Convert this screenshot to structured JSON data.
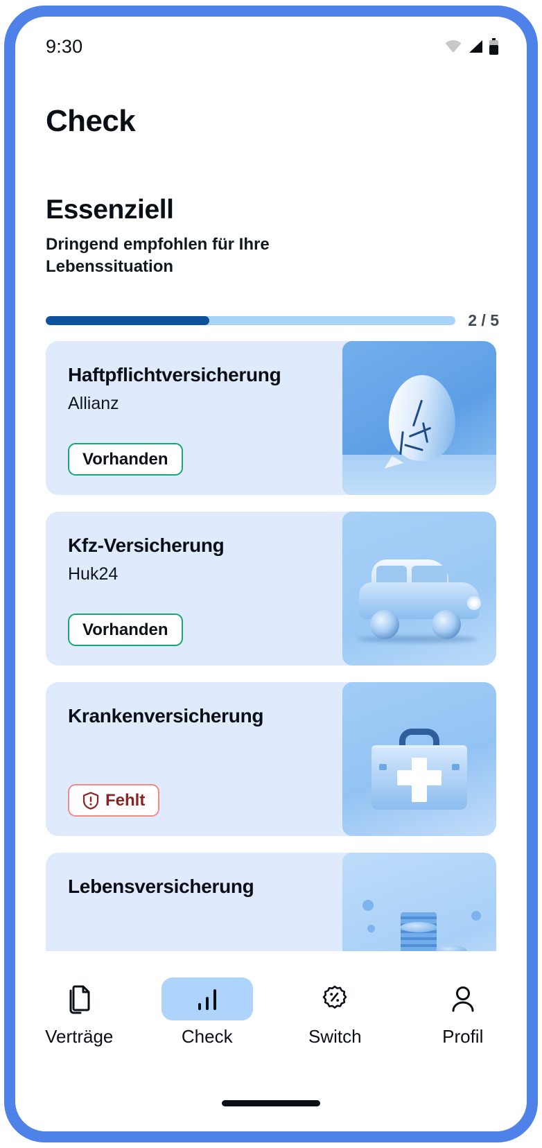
{
  "status_bar": {
    "time": "9:30",
    "icons": [
      "wifi-icon",
      "cellular-signal-icon",
      "battery-icon"
    ]
  },
  "header": {
    "title": "Check"
  },
  "section": {
    "title": "Essenziell",
    "subtitle": "Dringend empfohlen für Ihre Lebenssituation",
    "progress": {
      "current": 2,
      "total": 5,
      "label": "2 / 5",
      "percent": 40,
      "fill_color": "#0c529b",
      "track_color": "#a9d2f7"
    }
  },
  "cards": [
    {
      "title": "Haftpflichtversicherung",
      "provider": "Allianz",
      "badge": {
        "label": "Vorhanden",
        "state": "present",
        "color": "#14a870"
      },
      "image": "cracked-vase-illustration"
    },
    {
      "title": "Kfz-Versicherung",
      "provider": "Huk24",
      "badge": {
        "label": "Vorhanden",
        "state": "present",
        "color": "#14a870"
      },
      "image": "classic-car-illustration"
    },
    {
      "title": "Krankenversicherung",
      "provider": "",
      "badge": {
        "label": "Fehlt",
        "state": "missing",
        "color": "#8c2222",
        "icon": "shield-alert-icon"
      },
      "image": "first-aid-kit-illustration"
    },
    {
      "title": "Lebensversicherung",
      "provider": "",
      "badge": null,
      "image": "coin-stacks-illustration"
    }
  ],
  "bottom_nav": {
    "active": "Check",
    "items": [
      {
        "label": "Verträge",
        "icon": "documents-icon",
        "active": false
      },
      {
        "label": "Check",
        "icon": "bar-chart-icon",
        "active": true
      },
      {
        "label": "Switch",
        "icon": "percent-badge-icon",
        "active": false
      },
      {
        "label": "Profil",
        "icon": "person-icon",
        "active": false
      }
    ]
  },
  "theme": {
    "frame": "#4f82e8",
    "card_bg": "#dfebfd",
    "accent": "#0c529b",
    "nav_active_pill": "#aed4fb"
  }
}
